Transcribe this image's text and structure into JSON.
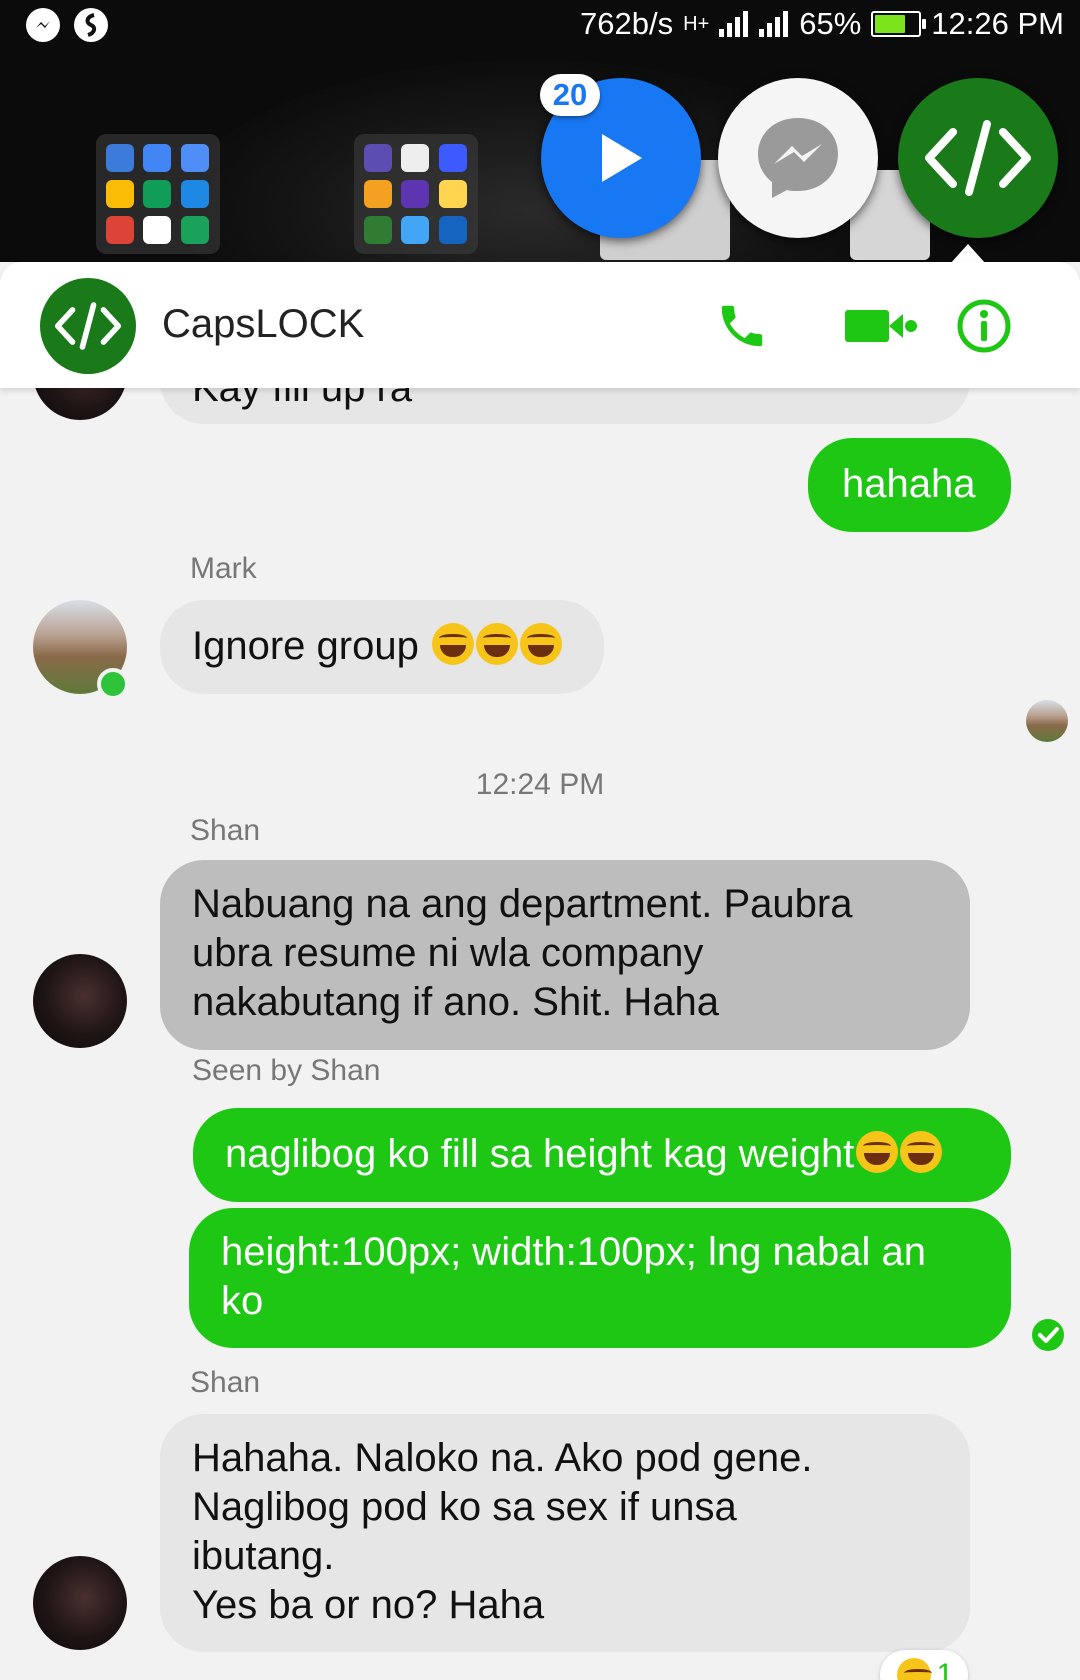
{
  "status_bar": {
    "net_speed": "762b/s",
    "network_type": "H+",
    "battery_percent": "65%",
    "battery_level": 0.65,
    "time": "12:26 PM"
  },
  "chat_heads": {
    "badge_count": "20"
  },
  "header": {
    "title": "CapsLOCK",
    "accent_color": "#1dc714"
  },
  "messages": {
    "m0_text": "Kay fill up ra",
    "m1_text": "hahaha",
    "m2_sender": "Mark",
    "m2_text": "Ignore group",
    "timestamp": "12:24 PM",
    "m3_sender": "Shan",
    "m3_line1": "Nabuang na ang department.  Paubra",
    "m3_line2": "ubra resume ni wla company",
    "m3_line3": "nakabutang if ano.  Shit. Haha",
    "seen": "Seen by Shan",
    "m4_text": "naglibog ko fill sa height kag weight",
    "m5_line1": "height:100px; width:100px; lng nabal an",
    "m5_line2": "ko",
    "m6_sender": "Shan",
    "m6_line1": "Hahaha.  Naloko na. Ako pod gene.",
    "m6_line2": "Naglibog pod ko sa sex if unsa",
    "m6_line3": "ibutang.",
    "m6_line4": "Yes ba or no? Haha",
    "reaction_count": "1"
  },
  "colors": {
    "outgoing": "#1dc714",
    "incoming": "#e6e6e6",
    "incoming_selected": "#bdbdbd",
    "messenger_blue": "#1877f2"
  }
}
